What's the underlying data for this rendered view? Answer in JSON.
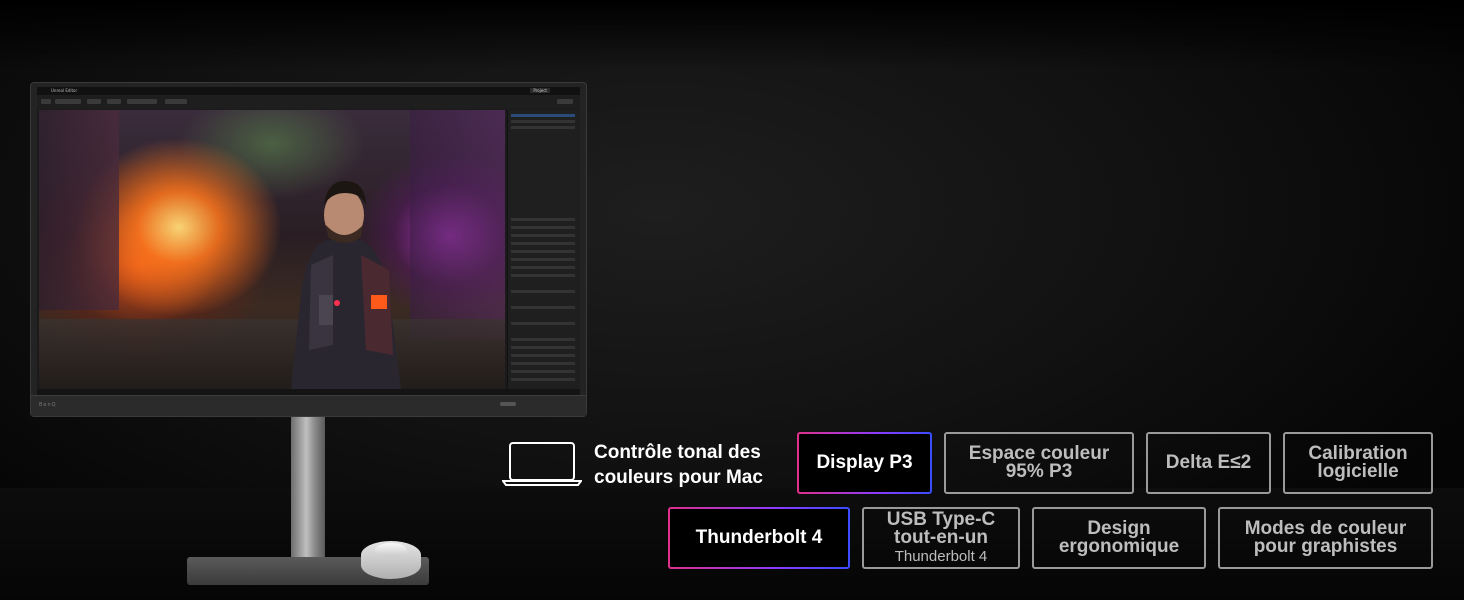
{
  "monitor": {
    "brand": "BenQ",
    "app_title": "Unreal Editor",
    "project_badge": "Project"
  },
  "feature_intro": {
    "laptop_icon": "laptop-icon",
    "line1": "Contrôle tonal des",
    "line2": "couleurs pour Mac"
  },
  "features_row1": [
    {
      "line1": "Display P3",
      "line2": "",
      "highlighted": true
    },
    {
      "line1": "Espace couleur",
      "line2": "95% P3",
      "highlighted": false
    },
    {
      "line1": "Delta E≤2",
      "line2": "",
      "highlighted": false
    },
    {
      "line1": "Calibration",
      "line2": "logicielle",
      "highlighted": false
    }
  ],
  "features_row2": [
    {
      "line1": "Thunderbolt 4",
      "line2": "",
      "highlighted": true
    },
    {
      "line1": "USB Type-C",
      "line2": "tout-en-un",
      "sub": "Thunderbolt 4",
      "highlighted": false
    },
    {
      "line1": "Design",
      "line2": "ergonomique",
      "highlighted": false
    },
    {
      "line1": "Modes de couleur",
      "line2": "pour graphistes",
      "highlighted": false
    }
  ],
  "colors": {
    "highlight_gradient_start": "#e0308a",
    "highlight_gradient_end": "#3a4cff",
    "badge_border": "#9a9a9a"
  }
}
